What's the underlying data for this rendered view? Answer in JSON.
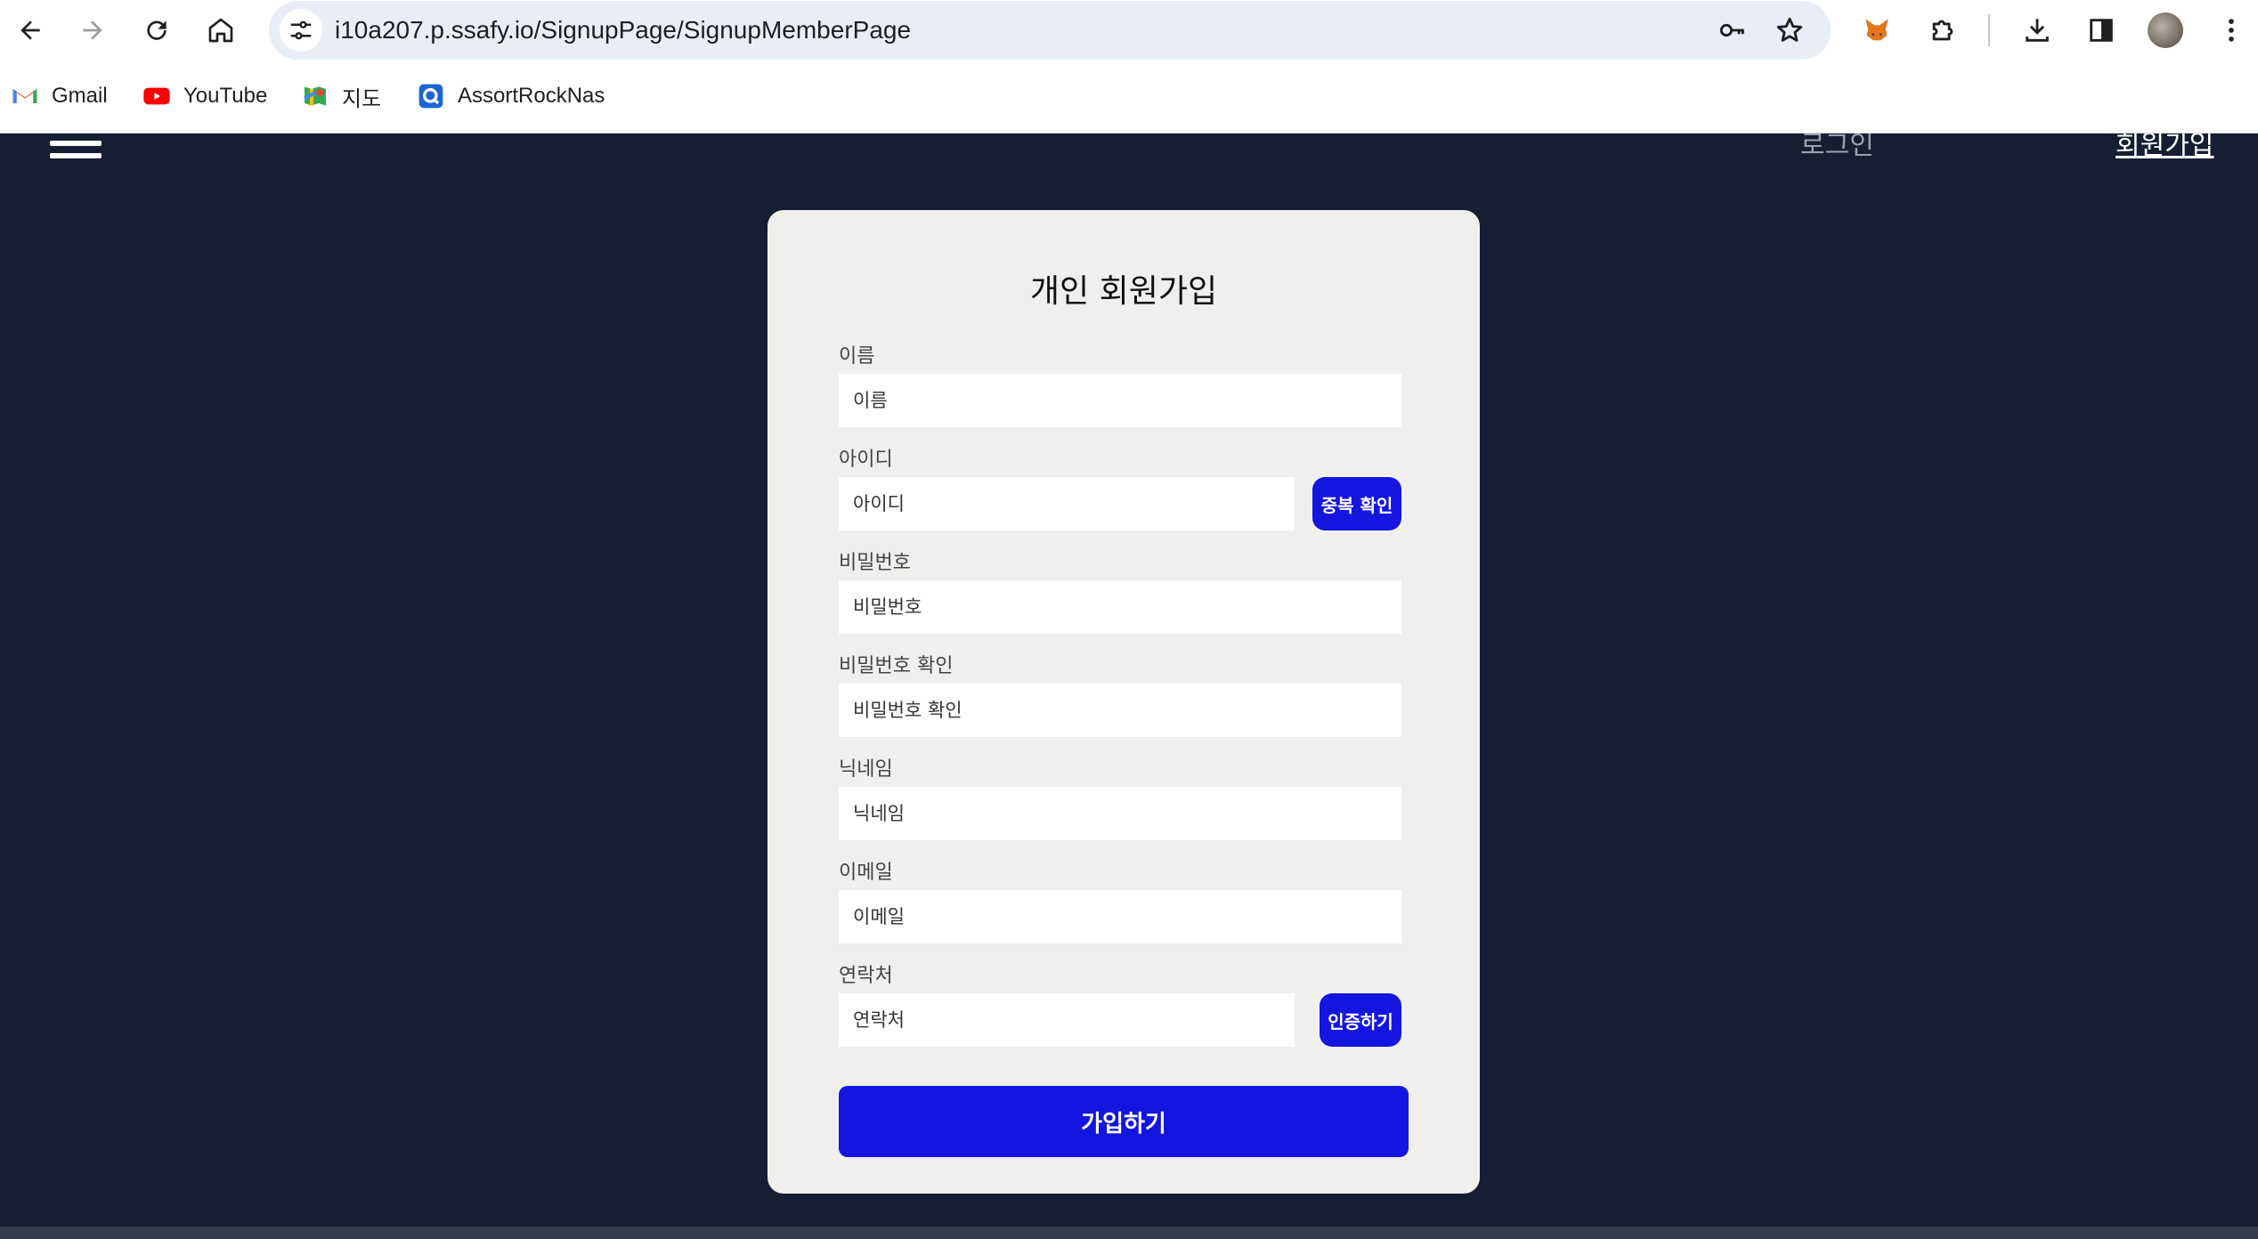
{
  "browser": {
    "url": "i10a207.p.ssafy.io/SignupPage/SignupMemberPage",
    "bookmarks": [
      {
        "label": "Gmail",
        "icon": "gmail-icon"
      },
      {
        "label": "YouTube",
        "icon": "youtube-icon"
      },
      {
        "label": "지도",
        "icon": "maps-icon"
      },
      {
        "label": "AssortRockNas",
        "icon": "nas-icon"
      }
    ]
  },
  "header": {
    "login_link": "로그인",
    "signup_link": "회원가입"
  },
  "form": {
    "title": "개인 회원가입",
    "fields": {
      "name": {
        "label": "이름",
        "placeholder": "이름"
      },
      "id": {
        "label": "아이디",
        "placeholder": "아이디",
        "button": "중복 확인"
      },
      "password": {
        "label": "비밀번호",
        "placeholder": "비밀번호"
      },
      "password_confirm": {
        "label": "비밀번호 확인",
        "placeholder": "비밀번호 확인"
      },
      "nickname": {
        "label": "닉네임",
        "placeholder": "닉네임"
      },
      "email": {
        "label": "이메일",
        "placeholder": "이메일"
      },
      "phone": {
        "label": "연락처",
        "placeholder": "연락처",
        "button": "인증하기"
      }
    },
    "submit_label": "가입하기"
  },
  "colors": {
    "page_background": "#161e33",
    "card_background": "#f0efed",
    "accent": "#1515e0"
  }
}
